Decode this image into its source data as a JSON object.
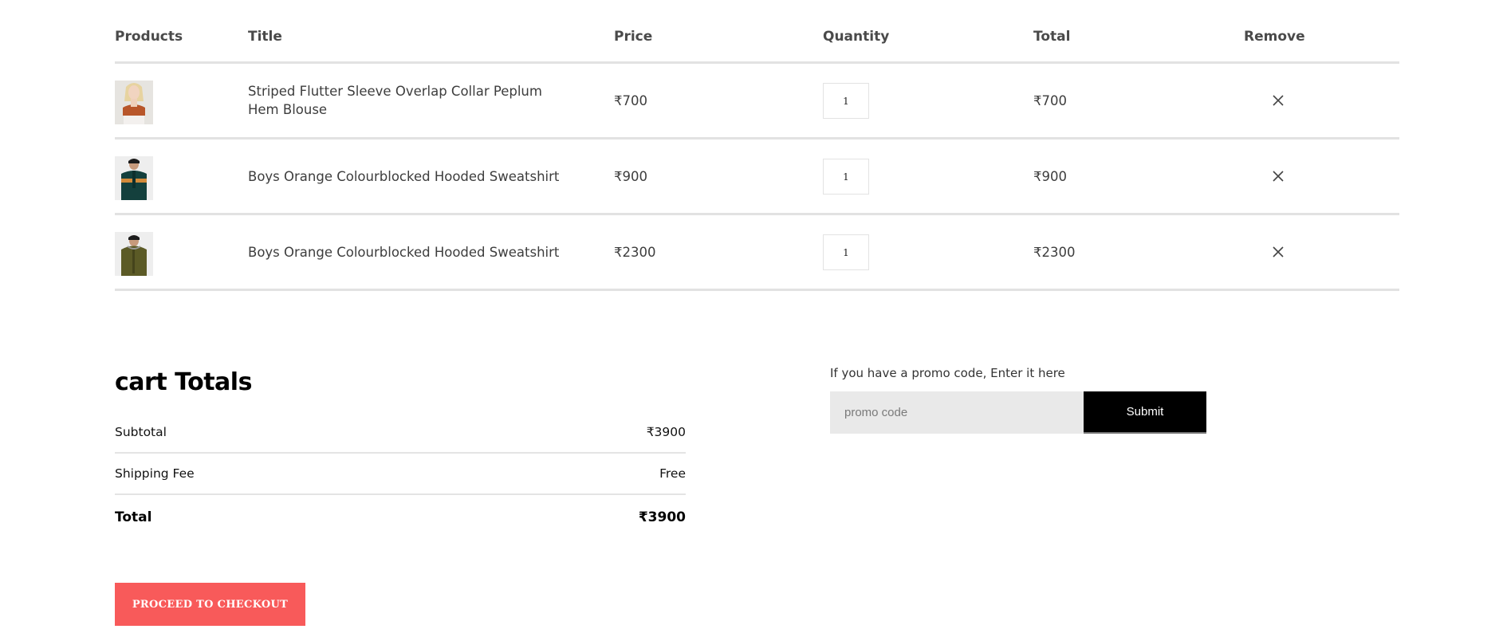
{
  "table": {
    "headers": {
      "products": "Products",
      "title": "Title",
      "price": "Price",
      "quantity": "Quantity",
      "total": "Total",
      "remove": "Remove"
    },
    "rows": [
      {
        "title": "Striped Flutter Sleeve Overlap Collar Peplum Hem Blouse",
        "price": "₹700",
        "quantity": "1",
        "total": "₹700",
        "image_icon": "product-woman-blouse-image",
        "remove_icon": "close-icon"
      },
      {
        "title": "Boys Orange Colourblocked Hooded Sweatshirt",
        "price": "₹900",
        "quantity": "1",
        "total": "₹900",
        "image_icon": "product-boy-sweatshirt-image",
        "remove_icon": "close-icon"
      },
      {
        "title": "Boys Orange Colourblocked Hooded Sweatshirt",
        "price": "₹2300",
        "quantity": "1",
        "total": "₹2300",
        "image_icon": "product-boy-jacket-image",
        "remove_icon": "close-icon"
      }
    ]
  },
  "totals": {
    "title": "cart Totals",
    "subtotal_label": "Subtotal",
    "subtotal_value": "₹3900",
    "shipping_label": "Shipping Fee",
    "shipping_value": "Free",
    "total_label": "Total",
    "total_value": "₹3900",
    "checkout_label": "PROCEED TO CHECKOUT"
  },
  "promo": {
    "label": "If you have a promo code, Enter it here",
    "placeholder": "promo code",
    "submit_label": "Submit"
  },
  "colors": {
    "checkout_button": "#f85a5a",
    "submit_button": "#000000",
    "promo_input_bg": "#e9e9e9",
    "divider": "#e2e2e2"
  }
}
